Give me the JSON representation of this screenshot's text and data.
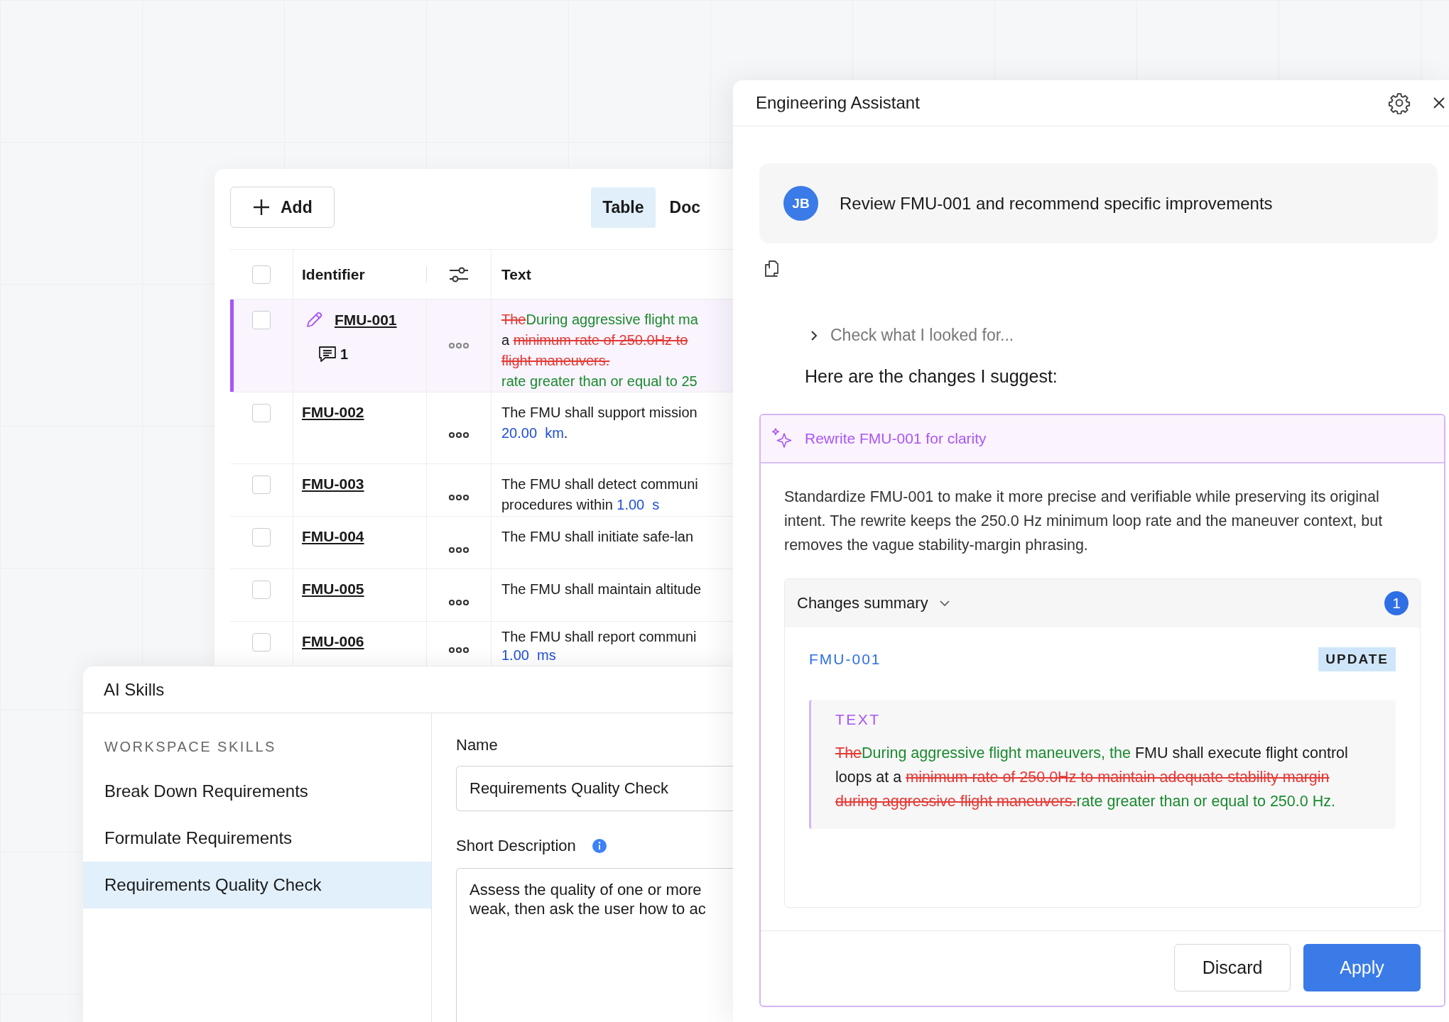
{
  "table_panel": {
    "add_button": "Add",
    "view_tabs": [
      {
        "label": "Table",
        "selected": true
      },
      {
        "label": "Doc",
        "selected": false
      }
    ],
    "header": {
      "checked": false,
      "columns": [
        "Identifier",
        "Text"
      ]
    },
    "rows": [
      {
        "id": "FMU-001",
        "selected": true,
        "checked": false,
        "editing": true,
        "comments": "1",
        "lines": [
          [
            {
              "kind": "del",
              "text": "The"
            },
            {
              "kind": "ins",
              "text": "During aggressive flight ma"
            }
          ],
          [
            {
              "kind": "plain",
              "text": "a "
            },
            {
              "kind": "del",
              "text": "minimum rate of 250.0Hz to"
            }
          ],
          [
            {
              "kind": "del",
              "text": "flight maneuvers."
            }
          ],
          [
            {
              "kind": "ins",
              "text": "rate greater than or equal to 25"
            }
          ]
        ]
      },
      {
        "id": "FMU-002",
        "selected": false,
        "checked": false,
        "lines": [
          [
            {
              "kind": "plain",
              "text": "The FMU shall support mission"
            }
          ],
          [
            {
              "kind": "value",
              "text": "20.00  km"
            },
            {
              "kind": "plain",
              "text": "."
            }
          ]
        ]
      },
      {
        "id": "FMU-003",
        "selected": false,
        "checked": false,
        "lines": [
          [
            {
              "kind": "plain",
              "text": "The FMU shall detect communi"
            }
          ],
          [
            {
              "kind": "plain",
              "text": "procedures within "
            },
            {
              "kind": "value",
              "text": "1.00  s"
            }
          ]
        ]
      },
      {
        "id": "FMU-004",
        "selected": false,
        "checked": false,
        "lines": [
          [
            {
              "kind": "plain",
              "text": "The FMU shall initiate safe-lan"
            }
          ]
        ]
      },
      {
        "id": "FMU-005",
        "selected": false,
        "checked": false,
        "lines": [
          [
            {
              "kind": "plain",
              "text": "The FMU shall maintain altitude"
            }
          ]
        ]
      },
      {
        "id": "FMU-006",
        "selected": false,
        "checked": false,
        "lines": [
          [
            {
              "kind": "plain",
              "text": "The FMU shall report communi"
            }
          ],
          [
            {
              "kind": "value",
              "text": "1.00  ms"
            }
          ]
        ]
      }
    ]
  },
  "assistant": {
    "title": "Engineering Assistant",
    "user": {
      "initials": "JB",
      "message": "Review FMU-001 and recommend specific improvements"
    },
    "reasoning_toggle": {
      "label": "Check what I looked for...",
      "expanded": false
    },
    "intro": "Here are the changes I suggest:",
    "suggestion": {
      "title": "Rewrite FMU-001 for clarity",
      "description": "Standardize FMU-001 to make it more precise and verifiable while preserving its original intent. The rewrite keeps the 250.0 Hz minimum loop rate and the maneuver context, but removes the vague stability-margin phrasing.",
      "summary": {
        "label": "Changes summary",
        "expanded": true,
        "count": "1",
        "change": {
          "id": "FMU-001",
          "action": "UPDATE",
          "field": "TEXT",
          "segments": [
            {
              "kind": "del",
              "text": "The"
            },
            {
              "kind": "ins",
              "text": "During aggressive flight maneuvers, the"
            },
            {
              "kind": "plain",
              "text": " FMU shall execute flight control loops at a "
            },
            {
              "kind": "del",
              "text": "minimum rate of 250.0Hz to maintain adequate stability margin during aggressive flight maneuvers."
            },
            {
              "kind": "ins",
              "text": "rate greater than or equal to 250.0 Hz."
            }
          ]
        }
      }
    },
    "buttons": [
      {
        "label": "Discard",
        "kind": "secondary"
      },
      {
        "label": "Apply",
        "kind": "primary"
      }
    ]
  },
  "ai_skills": {
    "title": "AI Skills",
    "section": "WORKSPACE SKILLS",
    "skills": [
      {
        "label": "Break Down Requirements",
        "selected": false
      },
      {
        "label": "Formulate Requirements",
        "selected": false
      },
      {
        "label": "Requirements Quality Check",
        "selected": true
      }
    ],
    "form": {
      "name_label": "Name",
      "name_value": "Requirements Quality Check",
      "description_label": "Short Description",
      "description_lines": [
        "Assess the quality of one or more",
        "weak, then ask the user how to ac"
      ]
    }
  }
}
